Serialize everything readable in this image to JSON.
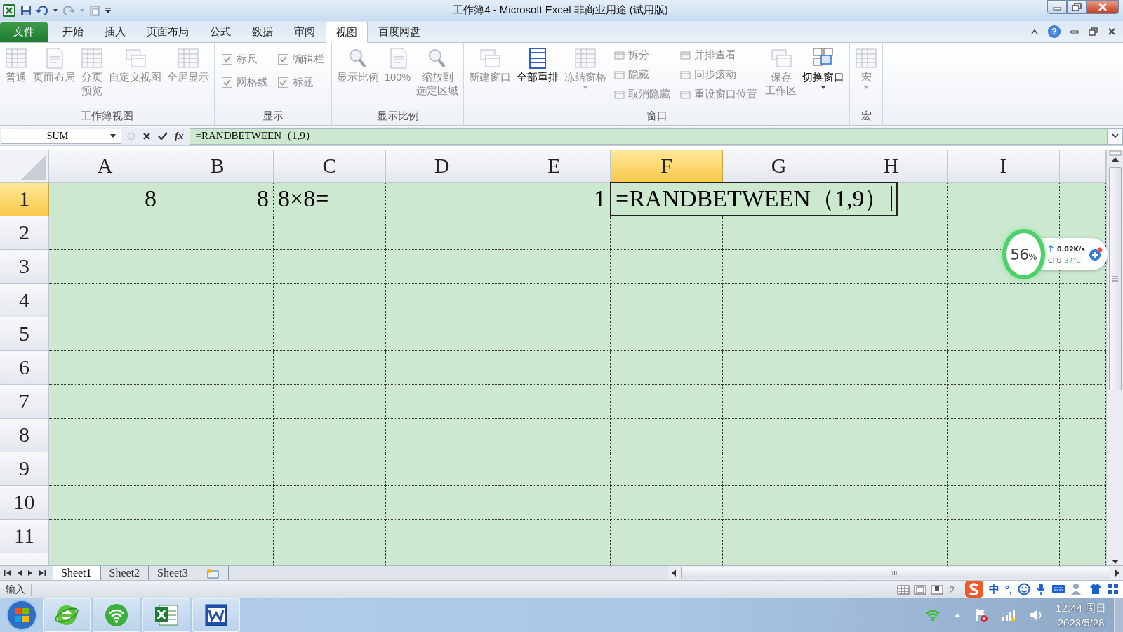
{
  "window": {
    "title": "工作簿4 - Microsoft Excel 非商业用途 (试用版)"
  },
  "file_tab": {
    "label": "文件"
  },
  "ribbon_tabs": [
    {
      "label": "开始",
      "selected": false
    },
    {
      "label": "插入",
      "selected": false
    },
    {
      "label": "页面布局",
      "selected": false
    },
    {
      "label": "公式",
      "selected": false
    },
    {
      "label": "数据",
      "selected": false
    },
    {
      "label": "审阅",
      "selected": false
    },
    {
      "label": "视图",
      "selected": true
    },
    {
      "label": "百度网盘",
      "selected": false
    }
  ],
  "help_button": "?",
  "ribbon_groups": [
    {
      "label": "工作簿视图",
      "items": [
        {
          "kind": "large",
          "label": "普通",
          "disabled": true,
          "dropdown": false
        },
        {
          "kind": "large",
          "label": "页面布局",
          "disabled": true,
          "dropdown": false
        },
        {
          "kind": "large",
          "lines": [
            "分页",
            "预览"
          ],
          "disabled": true,
          "dropdown": false
        },
        {
          "kind": "large",
          "label": "自定义视图",
          "disabled": true,
          "dropdown": false
        },
        {
          "kind": "large",
          "label": "全屏显示",
          "disabled": true,
          "dropdown": false
        }
      ]
    },
    {
      "label": "显示",
      "items": [
        {
          "kind": "check",
          "label": "标尺",
          "checked": true,
          "disabled": true
        },
        {
          "kind": "check",
          "label": "编辑栏",
          "checked": true,
          "disabled": true
        },
        {
          "kind": "check",
          "label": "网格线",
          "checked": true,
          "disabled": true
        },
        {
          "kind": "check",
          "label": "标题",
          "checked": true,
          "disabled": true
        }
      ]
    },
    {
      "label": "显示比例",
      "items": [
        {
          "kind": "large",
          "label": "显示比例",
          "disabled": true,
          "dropdown": false
        },
        {
          "kind": "large",
          "label": "100%",
          "disabled": true,
          "dropdown": false
        },
        {
          "kind": "large",
          "lines": [
            "缩放到",
            "选定区域"
          ],
          "disabled": true,
          "dropdown": false
        }
      ]
    },
    {
      "label": "窗口",
      "items": [
        {
          "kind": "large",
          "label": "新建窗口",
          "disabled": true,
          "dropdown": false
        },
        {
          "kind": "large",
          "label": "全部重排",
          "disabled": false,
          "dropdown": false
        },
        {
          "kind": "large",
          "label": "冻结窗格",
          "disabled": true,
          "dropdown": true
        },
        {
          "kind": "small",
          "label": "拆分",
          "disabled": true
        },
        {
          "kind": "small",
          "label": "隐藏",
          "disabled": true
        },
        {
          "kind": "small",
          "label": "取消隐藏",
          "disabled": true
        },
        {
          "kind": "small",
          "label": "并排查看",
          "disabled": true
        },
        {
          "kind": "small",
          "label": "同步滚动",
          "disabled": true
        },
        {
          "kind": "small",
          "label": "重设窗口位置",
          "disabled": true
        },
        {
          "kind": "large",
          "lines": [
            "保存",
            "工作区"
          ],
          "disabled": true,
          "dropdown": false
        },
        {
          "kind": "large",
          "label": "切换窗口",
          "disabled": false,
          "dropdown": true
        }
      ]
    },
    {
      "label": "宏",
      "items": [
        {
          "kind": "large",
          "label": "宏",
          "disabled": true,
          "dropdown": true
        }
      ]
    }
  ],
  "name_box": {
    "value": "SUM"
  },
  "formula_bar": {
    "function_button": "fx",
    "value": "=RANDBETWEEN（1,9）"
  },
  "columns": [
    {
      "label": "A",
      "selected": false
    },
    {
      "label": "B",
      "selected": false
    },
    {
      "label": "C",
      "selected": false
    },
    {
      "label": "D",
      "selected": false
    },
    {
      "label": "E",
      "selected": false
    },
    {
      "label": "F",
      "selected": true
    },
    {
      "label": "G",
      "selected": false
    },
    {
      "label": "H",
      "selected": false
    },
    {
      "label": "I",
      "selected": false
    }
  ],
  "rows": [
    {
      "header": "1",
      "selected": true,
      "cells": [
        {
          "kind": "number",
          "value": "8"
        },
        {
          "kind": "number",
          "value": "8"
        },
        {
          "kind": "text",
          "value": "8×8="
        },
        {
          "kind": "empty"
        },
        {
          "kind": "number",
          "value": "1"
        },
        {
          "kind": "editing",
          "value": "=RANDBETWEEN（1,9）"
        },
        {
          "kind": "empty"
        },
        {
          "kind": "empty"
        },
        {
          "kind": "empty"
        }
      ]
    },
    {
      "header": "2",
      "selected": false
    },
    {
      "header": "3",
      "selected": false
    },
    {
      "header": "4",
      "selected": false
    },
    {
      "header": "5",
      "selected": false
    },
    {
      "header": "6",
      "selected": false
    },
    {
      "header": "7",
      "selected": false
    },
    {
      "header": "8",
      "selected": false
    },
    {
      "header": "9",
      "selected": false
    },
    {
      "header": "10",
      "selected": false
    },
    {
      "header": "11",
      "selected": false
    }
  ],
  "sheet_tabs": [
    {
      "label": "Sheet1",
      "selected": true
    },
    {
      "label": "Sheet2",
      "selected": false
    },
    {
      "label": "Sheet3",
      "selected": false
    }
  ],
  "status_bar": {
    "mode": "输入",
    "zoom": "2"
  },
  "ime_bar": {
    "language": "中",
    "punctuation": "°,"
  },
  "monitor_widget": {
    "cpu_usage": "56",
    "percent_sign": "%",
    "network_speed": "0.02K/s",
    "cpu_label": "CPU",
    "cpu_temp": "37°C"
  },
  "clock": {
    "time": "12:44 周日",
    "date": "2023/5/28"
  }
}
